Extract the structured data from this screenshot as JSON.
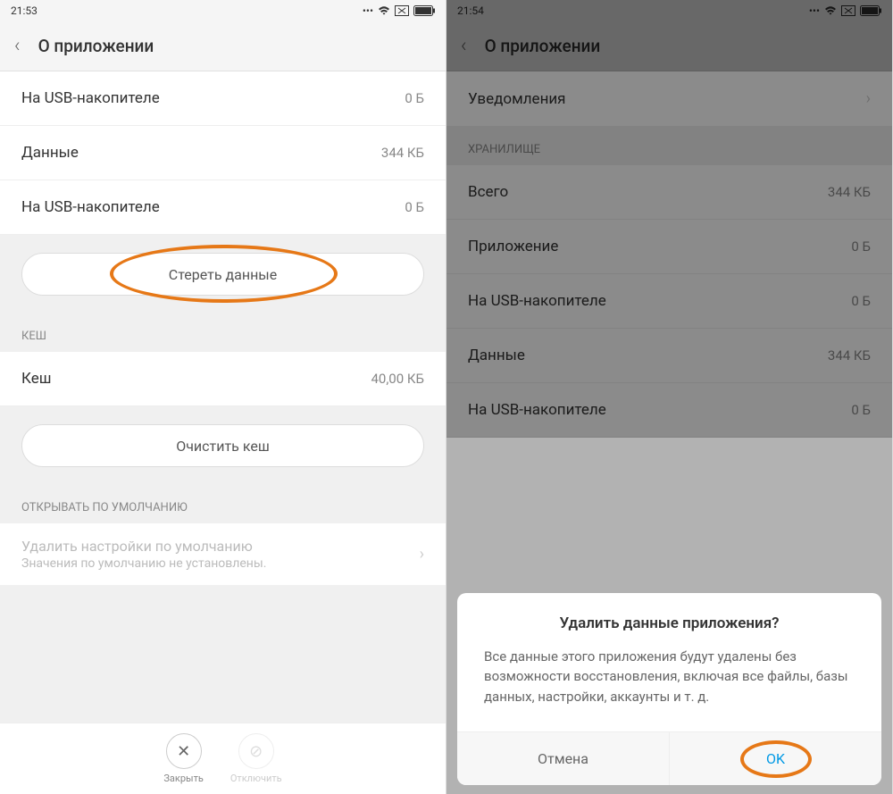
{
  "left": {
    "status": {
      "time": "21:53",
      "icons": {
        "dots": "...",
        "wifi": "wifi",
        "box": "box",
        "battery": "battery"
      }
    },
    "header": {
      "title": "О приложении"
    },
    "items": [
      {
        "label": "На USB-накопителе",
        "value": "0 Б"
      },
      {
        "label": "Данные",
        "value": "344 КБ"
      },
      {
        "label": "На USB-накопителе",
        "value": "0 Б"
      }
    ],
    "erase_button": "Стереть данные",
    "cache_header": "КЕШ",
    "cache_item": {
      "label": "Кеш",
      "value": "40,00 КБ"
    },
    "clear_cache_button": "Очистить кеш",
    "defaults_header": "ОТКРЫВАТЬ ПО УМОЛЧАНИЮ",
    "defaults_title": "Удалить настройки по умолчанию",
    "defaults_sub": "Значения по умолчанию не установлены.",
    "bottom": {
      "close": "Закрыть",
      "disable": "Отключить"
    }
  },
  "right": {
    "status": {
      "time": "21:54"
    },
    "header": {
      "title": "О приложении"
    },
    "notifications": {
      "label": "Уведомления"
    },
    "storage_header": "ХРАНИЛИЩЕ",
    "items": [
      {
        "label": "Всего",
        "value": "344 КБ"
      },
      {
        "label": "Приложение",
        "value": "0 Б"
      },
      {
        "label": "На USB-накопителе",
        "value": "0 Б"
      },
      {
        "label": "Данные",
        "value": "344 КБ"
      },
      {
        "label": "На USB-накопителе",
        "value": "0 Б"
      }
    ],
    "dialog": {
      "title": "Удалить данные приложения?",
      "body": "Все данные этого приложения будут удалены без возможности восстановления, включая все файлы, базы данных, настройки, аккаунты и т. д.",
      "cancel": "Отмена",
      "ok": "OK"
    }
  }
}
